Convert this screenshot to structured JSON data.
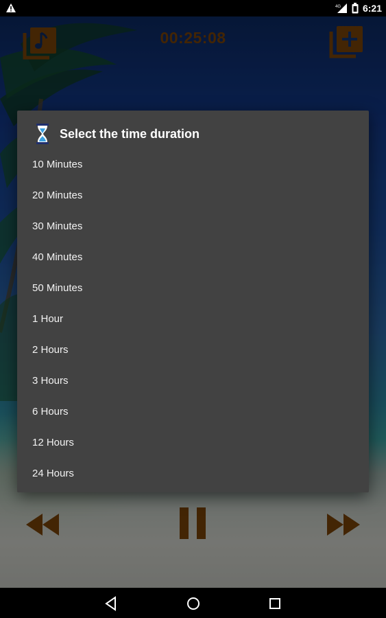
{
  "status_bar": {
    "time": "6:21",
    "network": "4G",
    "icons": [
      "warning-icon",
      "signal-icon",
      "battery-icon"
    ]
  },
  "app_bar": {
    "timer": "00:25:08",
    "icons": [
      "playlist-music-icon",
      "add-to-playlist-icon"
    ]
  },
  "dialog": {
    "title": "Select the time duration",
    "icon": "hourglass-icon",
    "options": [
      "10 Minutes",
      "20 Minutes",
      "30 Minutes",
      "40 Minutes",
      "50 Minutes",
      "1 Hour",
      "2 Hours",
      "3 Hours",
      "6 Hours",
      "12 Hours",
      "24 Hours"
    ]
  },
  "player_controls": {
    "icons": [
      "rewind-icon",
      "pause-icon",
      "fast-forward-icon"
    ]
  },
  "nav_bar": {
    "icons": [
      "back-icon",
      "home-icon",
      "recents-icon"
    ]
  },
  "colors": {
    "accent": "#7a4409",
    "dialog_background": "#424242",
    "dialog_text": "#ffffff"
  }
}
